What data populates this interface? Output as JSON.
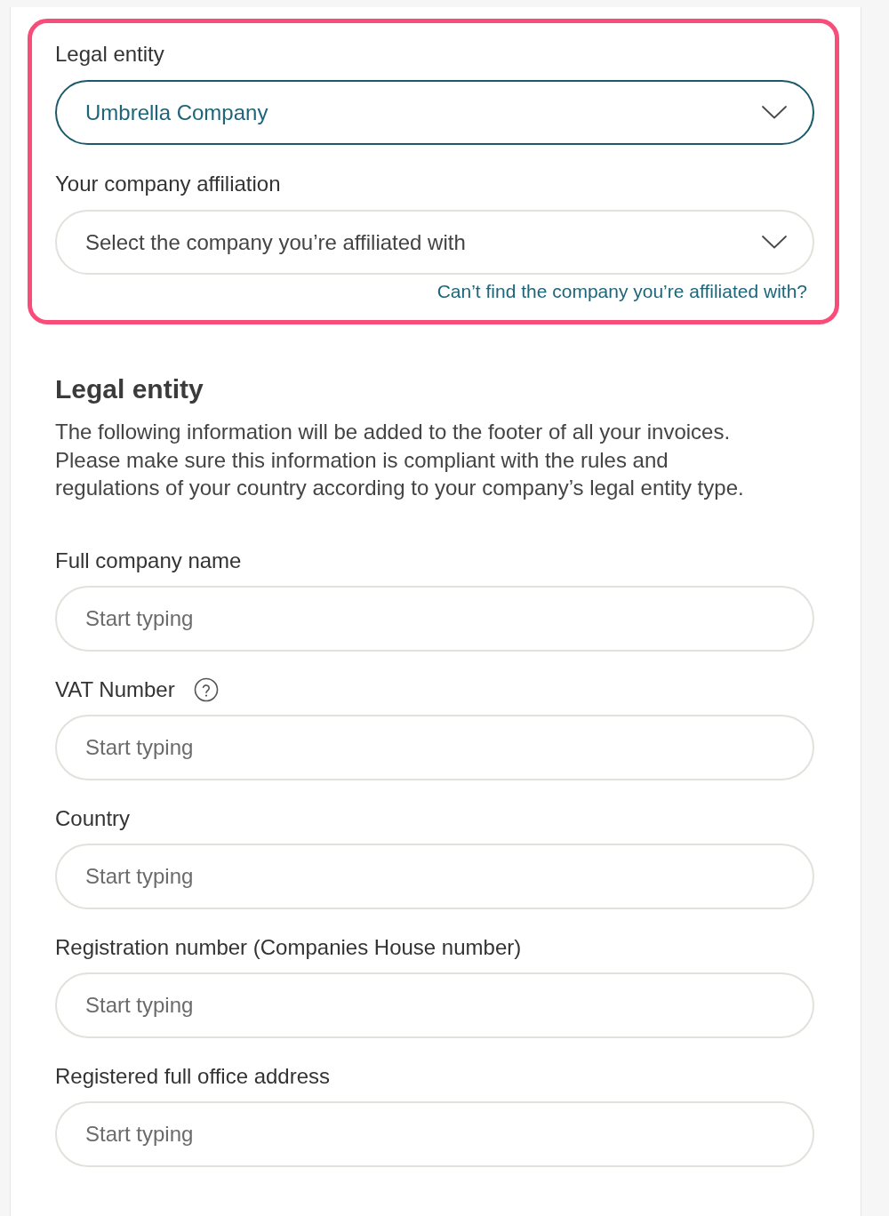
{
  "highlighted_group": {
    "highlighted": true,
    "fields": [
      {
        "label": "Legal entity",
        "value": "Umbrella Company",
        "focused": true
      },
      {
        "label": "Your company affiliation",
        "placeholder": "Select the company you’re affiliated with",
        "focused": false
      }
    ],
    "help_link": "Can’t find the company you’re affiliated with?"
  },
  "section": {
    "title": "Legal entity",
    "description": "The following information will be added to the footer of all your invoices. Please make sure this information is compliant with the rules and regulations of your country according to your company’s legal entity type.",
    "fields": [
      {
        "label": "Full company name",
        "placeholder": "Start typing",
        "help_icon": false
      },
      {
        "label": "VAT Number",
        "placeholder": "Start typing",
        "help_icon": true
      },
      {
        "label": "Country",
        "placeholder": "Start typing",
        "help_icon": false
      },
      {
        "label": "Registration number (Companies House number)",
        "placeholder": "Start typing",
        "help_icon": false
      },
      {
        "label": "Registered full office address",
        "placeholder": "Start typing",
        "help_icon": false
      }
    ]
  }
}
